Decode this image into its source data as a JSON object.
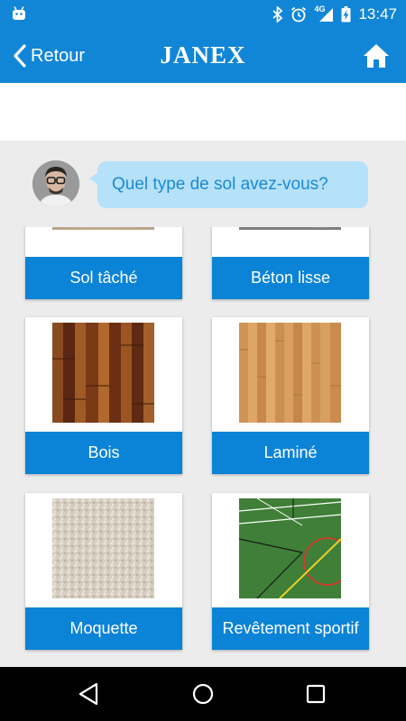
{
  "status_bar": {
    "time": "13:47",
    "network": "4G",
    "icons": [
      "android-icon",
      "bluetooth-icon",
      "alarm-icon",
      "signal-icon",
      "battery-icon"
    ]
  },
  "app_bar": {
    "back_label": "Retour",
    "brand": "JANEX",
    "home_icon": "home-icon"
  },
  "question": {
    "text": "Quel type de sol avez-vous?"
  },
  "options": [
    {
      "label": "Sol tâché",
      "texture": "stained-floor"
    },
    {
      "label": "Béton lisse",
      "texture": "smooth-concrete"
    },
    {
      "label": "Bois",
      "texture": "wood-planks"
    },
    {
      "label": "Laminé",
      "texture": "laminate"
    },
    {
      "label": "Moquette",
      "texture": "carpet"
    },
    {
      "label": "Revêtement sportif",
      "texture": "sports-floor"
    }
  ],
  "colors": {
    "primary": "#1186d6",
    "button": "#0b83d6",
    "bubble": "#b5e1f9",
    "bubble_text": "#1a8ad3",
    "background": "#ececec"
  }
}
